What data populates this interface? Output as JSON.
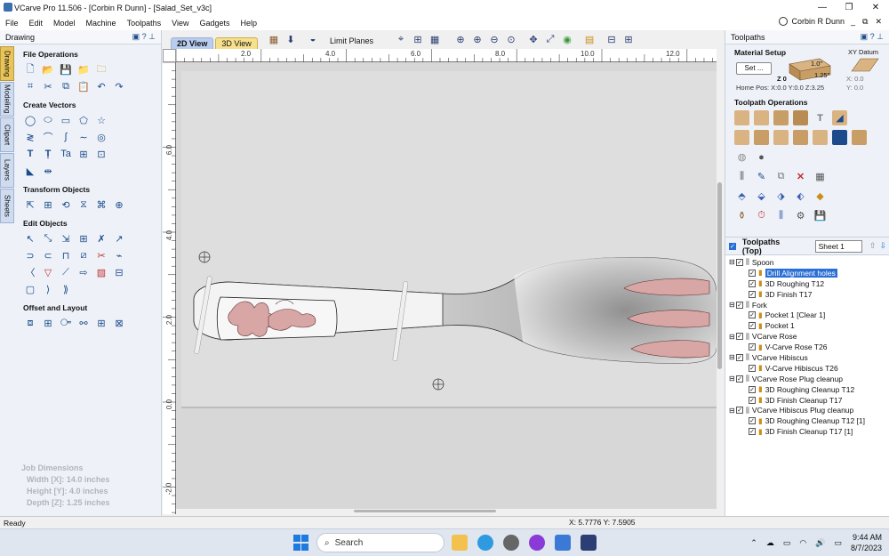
{
  "window": {
    "title": "VCarve Pro 11.506 - [Corbin R Dunn] - [Salad_Set_v3c]",
    "buttons": [
      "—",
      "❐",
      "✕"
    ]
  },
  "menu": {
    "items": [
      "File",
      "Edit",
      "Model",
      "Machine",
      "Toolpaths",
      "View",
      "Gadgets",
      "Help"
    ],
    "user": "Corbin R Dunn"
  },
  "left_panel": {
    "title": "Drawing",
    "vertical_tabs": [
      "Drawing",
      "Modeling",
      "Clipart",
      "Layers",
      "Sheets"
    ],
    "sections": {
      "file_ops": "File Operations",
      "create_vectors": "Create Vectors",
      "transform": "Transform Objects",
      "edit": "Edit Objects",
      "offset": "Offset and Layout"
    },
    "job_dimensions": {
      "title": "Job Dimensions",
      "width": "Width  [X]: 14.0 inches",
      "height": "Height [Y]: 4.0 inches",
      "depth": "Depth  [Z]: 1.25 inches"
    }
  },
  "view_tabs": [
    "2D View",
    "3D View"
  ],
  "toolbar": {
    "limit_planes": "Limit Planes"
  },
  "ruler": {
    "top_labels": [
      "2.0",
      "4.0",
      "6.0",
      "8.0",
      "10.0",
      "12.0"
    ],
    "left_labels": [
      "6.0",
      "4.0",
      "2.0",
      "0.0",
      "-2.0"
    ]
  },
  "right_panel": {
    "title": "Toolpaths",
    "material_setup": "Material Setup",
    "set_button": "Set ...",
    "thickness_top": "1.0\"",
    "thickness_total": "1.25\"",
    "z_zero": "Z 0",
    "home_pos": "Home Pos:  X:0.0 Y:0.0 Z:3.25",
    "xy_datum": "XY Datum",
    "datum_x": "X: 0.0",
    "datum_y": "Y: 0.0",
    "toolpath_operations": "Toolpath Operations",
    "list_title": "Toolpaths (Top)",
    "sheet": "Sheet 1",
    "groups": [
      {
        "name": "Spoon",
        "items": [
          "Drill Alignment holes",
          "3D Roughing T12",
          "3D Finish T17"
        ]
      },
      {
        "name": "Fork",
        "items": [
          "Pocket 1 [Clear 1]",
          "Pocket 1"
        ]
      },
      {
        "name": "VCarve Rose",
        "items": [
          "V-Carve Rose T26"
        ]
      },
      {
        "name": "VCarve Hibiscus",
        "items": [
          "V-Carve Hibiscus T26"
        ]
      },
      {
        "name": "VCarve Rose Plug cleanup",
        "items": [
          "3D Roughing Cleanup T12",
          "3D Finish Cleanup  T17"
        ]
      },
      {
        "name": "VCarve Hibiscus Plug cleanup",
        "items": [
          "3D Roughing Cleanup T12 [1]",
          "3D Finish Cleanup  T17 [1]"
        ]
      }
    ]
  },
  "status": {
    "left": "Ready",
    "coords": "X:  5.7776 Y:  7.5905"
  },
  "taskbar": {
    "search": "Search",
    "time": "9:44 AM",
    "date": "8/7/2023"
  },
  "colors": {
    "accent": "#2a6fd6",
    "drawing_tab": "#e8c45a",
    "selection_pink": "#d9a6a6"
  }
}
